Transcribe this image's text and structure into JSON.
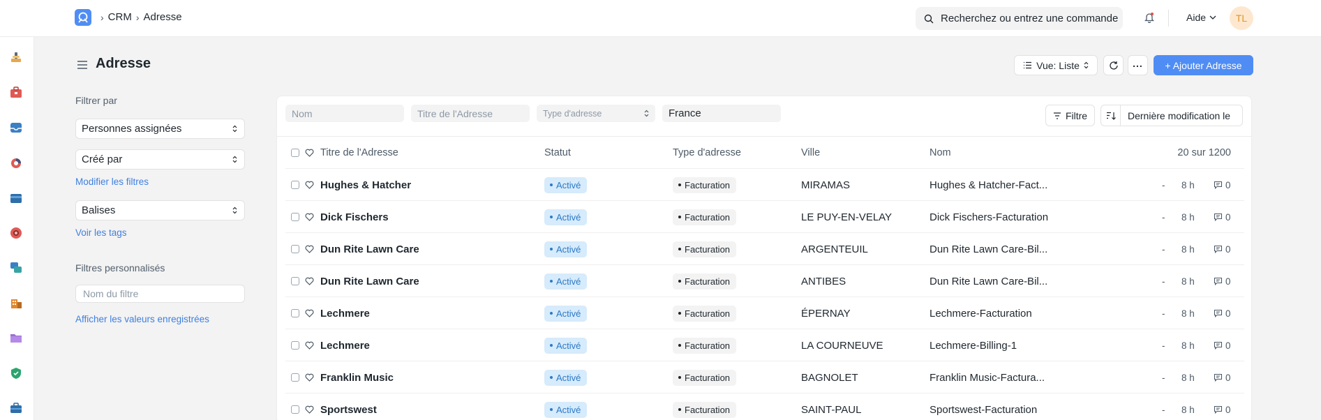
{
  "header": {
    "breadcrumbs": [
      "CRM",
      "Adresse"
    ],
    "search_placeholder": "Recherchez ou entrez une commande",
    "help_label": "Aide",
    "avatar_initials": "TL"
  },
  "sidebar_icons": [
    "tools-icon",
    "toolbox-icon",
    "inbox-icon",
    "pie-chart-icon",
    "card-icon",
    "support-icon",
    "chat-icon",
    "building-icon",
    "folder-icon",
    "shield-icon",
    "briefcase-icon"
  ],
  "page": {
    "title": "Adresse",
    "view_label": "Vue: Liste",
    "add_label": "+ Ajouter Adresse"
  },
  "filters_panel": {
    "filter_by": "Filtrer par",
    "assigned": "Personnes assignées",
    "created_by": "Créé par",
    "edit_filters": "Modifier les filtres",
    "tags": "Balises",
    "see_tags": "Voir les tags",
    "custom_filters": "Filtres personnalisés",
    "filter_name_placeholder": "Nom du filtre",
    "show_saved": "Afficher les valeurs enregistrées"
  },
  "list_filters": {
    "name_placeholder": "Nom",
    "title_placeholder": "Titre de l'Adresse",
    "type_placeholder": "Type d'adresse",
    "country_value": "France",
    "filter_btn": "Filtre",
    "sort_label": "Dernière modification le"
  },
  "table": {
    "headers": {
      "title": "Titre de l'Adresse",
      "status": "Statut",
      "type": "Type d'adresse",
      "city": "Ville",
      "name": "Nom",
      "count": "20 sur 1200"
    },
    "rows": [
      {
        "title": "Hughes & Hatcher",
        "status": "Activé",
        "type": "Facturation",
        "city": "MIRAMAS",
        "name": "Hughes & Hatcher-Fact...",
        "dash": "-",
        "time": "8 h",
        "comments": "0"
      },
      {
        "title": "Dick Fischers",
        "status": "Activé",
        "type": "Facturation",
        "city": "LE PUY-EN-VELAY",
        "name": "Dick Fischers-Facturation",
        "dash": "-",
        "time": "8 h",
        "comments": "0"
      },
      {
        "title": "Dun Rite Lawn Care",
        "status": "Activé",
        "type": "Facturation",
        "city": "ARGENTEUIL",
        "name": "Dun Rite Lawn Care-Bil...",
        "dash": "-",
        "time": "8 h",
        "comments": "0"
      },
      {
        "title": "Dun Rite Lawn Care",
        "status": "Activé",
        "type": "Facturation",
        "city": "ANTIBES",
        "name": "Dun Rite Lawn Care-Bil...",
        "dash": "-",
        "time": "8 h",
        "comments": "0"
      },
      {
        "title": "Lechmere",
        "status": "Activé",
        "type": "Facturation",
        "city": "ÉPERNAY",
        "name": "Lechmere-Facturation",
        "dash": "-",
        "time": "8 h",
        "comments": "0"
      },
      {
        "title": "Lechmere",
        "status": "Activé",
        "type": "Facturation",
        "city": "LA COURNEUVE",
        "name": "Lechmere-Billing-1",
        "dash": "-",
        "time": "8 h",
        "comments": "0"
      },
      {
        "title": "Franklin Music",
        "status": "Activé",
        "type": "Facturation",
        "city": "BAGNOLET",
        "name": "Franklin Music-Factura...",
        "dash": "-",
        "time": "8 h",
        "comments": "0"
      },
      {
        "title": "Sportswest",
        "status": "Activé",
        "type": "Facturation",
        "city": "SAINT-PAUL",
        "name": "Sportswest-Facturation",
        "dash": "-",
        "time": "8 h",
        "comments": "0"
      }
    ]
  }
}
